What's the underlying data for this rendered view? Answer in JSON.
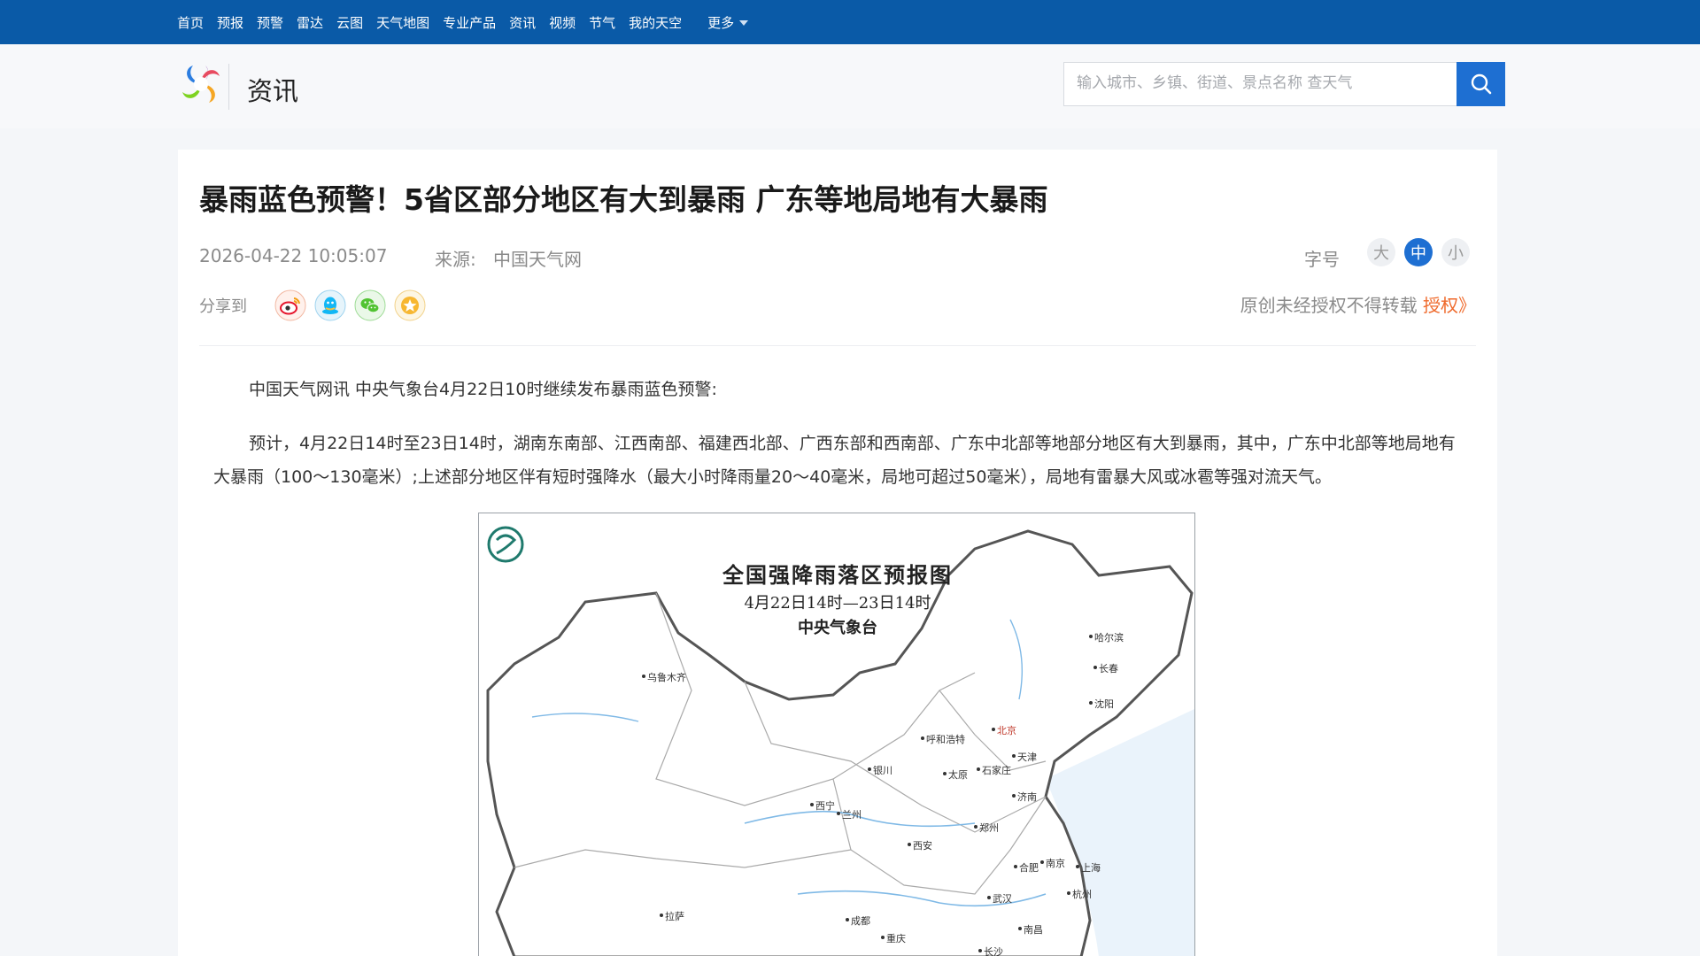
{
  "nav": {
    "items": [
      "首页",
      "预报",
      "预警",
      "雷达",
      "云图",
      "天气地图",
      "专业产品",
      "资讯",
      "视频",
      "节气",
      "我的天空"
    ],
    "more": "更多"
  },
  "header": {
    "section": "资讯",
    "search_placeholder": "输入城市、乡镇、街道、景点名称 查天气"
  },
  "article": {
    "title": "暴雨蓝色预警！5省区部分地区有大到暴雨 广东等地局地有大暴雨",
    "date": "2026-04-22 10:05:07",
    "source_label": "来源:",
    "source": "中国天气网",
    "fontsize_label": "字号",
    "fontsize_options": [
      "大",
      "中",
      "小"
    ],
    "share_label": "分享到",
    "copyright_text": "原创未经授权不得转载",
    "copyright_link": "授权》",
    "para1": "中国天气网讯 中央气象台4月22日10时继续发布暴雨蓝色预警:",
    "para2": "预计，4月22日14时至23日14时，湖南东南部、江西南部、福建西北部、广西东部和西南部、广东中北部等地部分地区有大到暴雨，其中，广东中北部等地局地有大暴雨（100～130毫米）;上述部分地区伴有短时强降水（最大小时降雨量20～40毫米，局地可超过50毫米），局地有雷暴大风或冰雹等强对流天气。"
  },
  "map": {
    "title": "全国强降雨落区预报图",
    "subtitle": "4月22日14时—23日14时",
    "agency": "中央气象台",
    "cities": [
      "乌鲁木齐",
      "哈尔滨",
      "长春",
      "沈阳",
      "呼和浩特",
      "北京",
      "天津",
      "石家庄",
      "太原",
      "银川",
      "西宁",
      "兰州",
      "济南",
      "郑州",
      "西安",
      "合肥",
      "南京",
      "上海",
      "杭州",
      "武汉",
      "拉萨",
      "成都",
      "重庆",
      "长沙",
      "南昌"
    ]
  },
  "colors": {
    "nav_bg": "#0a5aa7",
    "accent": "#1e6fd2",
    "link": "#ef6a2c"
  }
}
